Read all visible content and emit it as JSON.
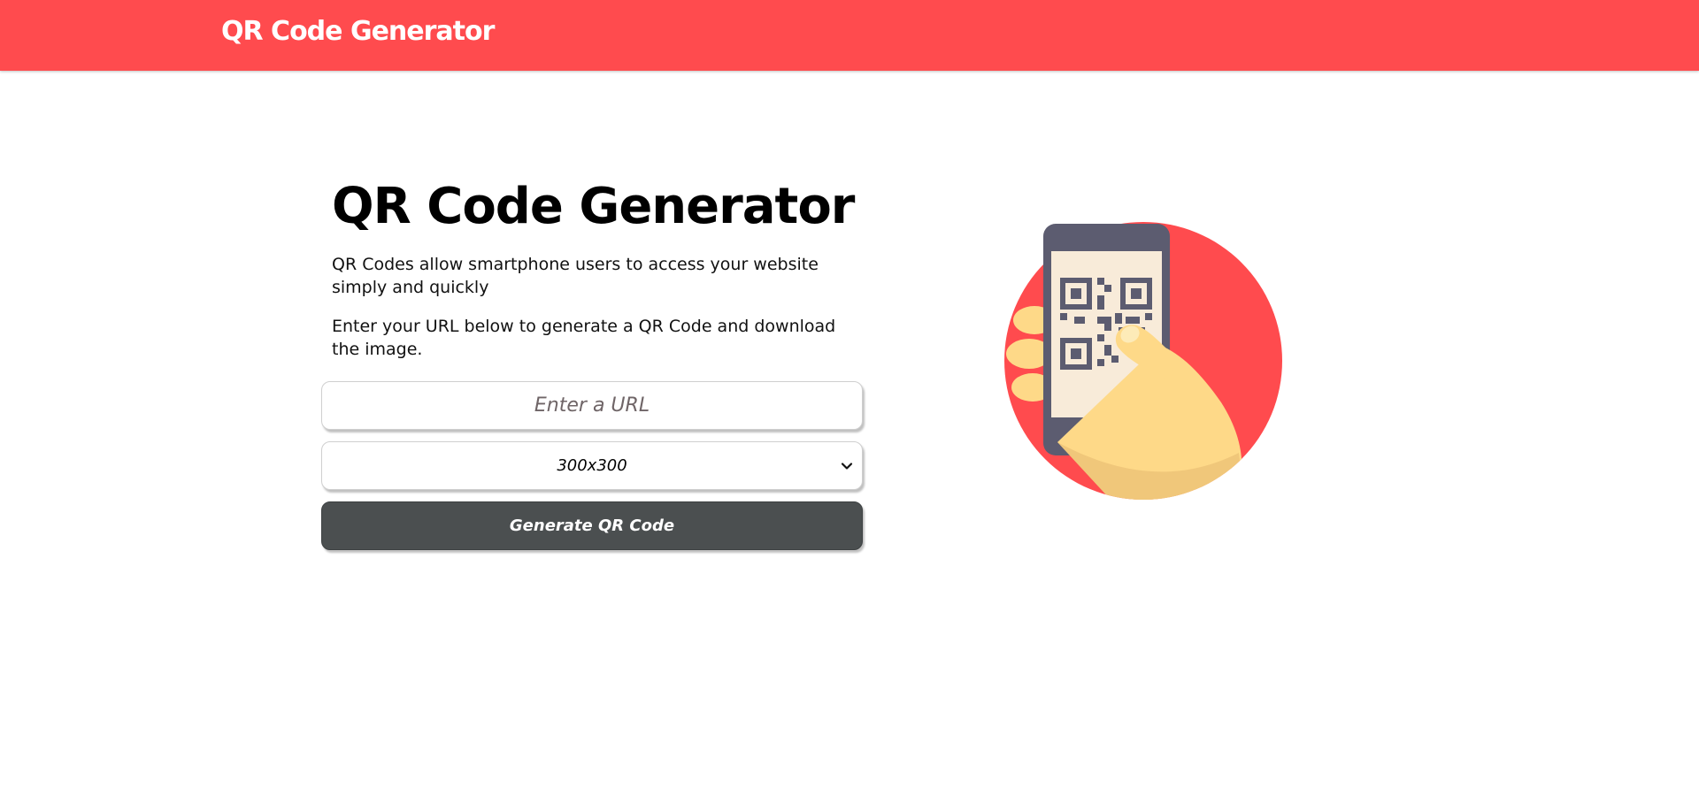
{
  "header": {
    "brand": "QR Code Generator",
    "bg_color": "#ff4b4e"
  },
  "main": {
    "title": "QR Code Generator",
    "description": "QR Codes allow smartphone users to access your website simply and quickly",
    "instruction": "Enter your URL below to generate a QR Code and download the image."
  },
  "form": {
    "url_placeholder": "Enter a URL",
    "url_value": "",
    "size_selected": "300x300",
    "generate_label": "Generate QR Code",
    "button_color": "#4b4f50"
  },
  "illustration": {
    "icon": "phone-scanning-qr-icon",
    "circle_color": "#ff4b4e",
    "phone_color": "#5c5c70",
    "screen_color": "#f8ebd9",
    "hand_color": "#fed988"
  }
}
